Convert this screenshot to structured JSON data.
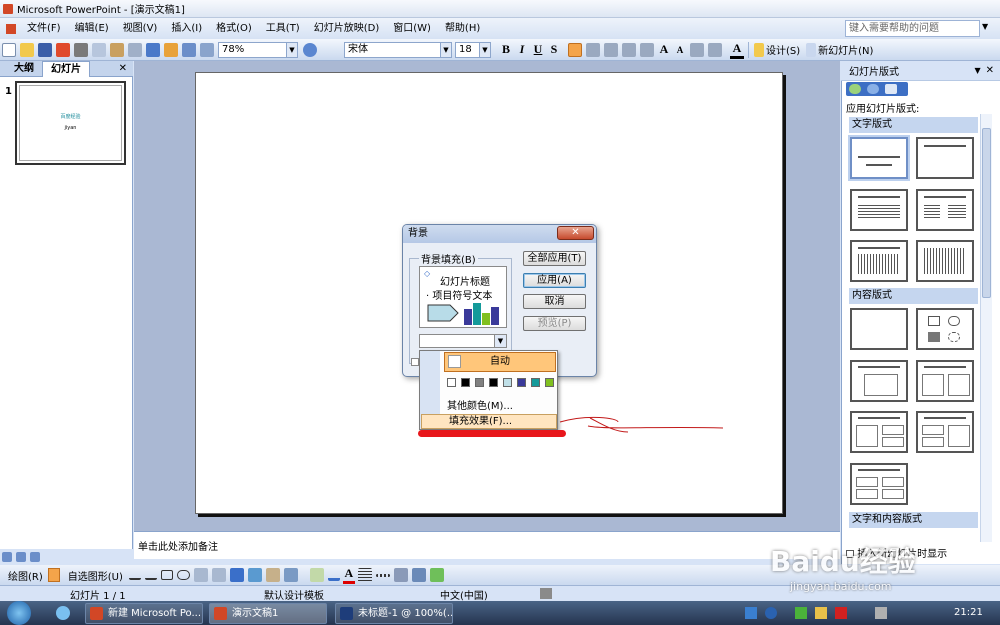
{
  "title_bar": {
    "title": "Microsoft PowerPoint - [演示文稿1]"
  },
  "menu": {
    "items": [
      "文件(F)",
      "编辑(E)",
      "视图(V)",
      "插入(I)",
      "格式(O)",
      "工具(T)",
      "幻灯片放映(D)",
      "窗口(W)",
      "帮助(H)"
    ],
    "help_placeholder": "键入需要帮助的问题"
  },
  "toolbar": {
    "zoom": "78%",
    "font": "宋体",
    "font_size": "18",
    "bold": "B",
    "italic": "I",
    "underline": "U",
    "shadow": "S",
    "design_label": "设计(S)",
    "new_slide_label": "新幻灯片(N)"
  },
  "left_pane": {
    "tabs": [
      "大纲",
      "幻灯片"
    ],
    "slide_number": "1",
    "thumb_title": "百度经验",
    "thumb_sub": "jiyan"
  },
  "notes": {
    "placeholder": "单击此处添加备注"
  },
  "task_pane": {
    "title": "幻灯片版式",
    "apply_label": "应用幻灯片版式:",
    "sections": [
      "文字版式",
      "内容版式",
      "文字和内容版式"
    ],
    "footer": "插入新幻灯片时显示"
  },
  "dialog": {
    "title": "背景",
    "group_label": "背景填充(B)",
    "preview_title": "幻灯片标题",
    "preview_bullet": "· 项目符号文本",
    "buttons": {
      "apply_all": "全部应用(T)",
      "apply": "应用(A)",
      "cancel": "取消",
      "preview": "预览(P)"
    },
    "popup": {
      "auto": "自动",
      "more_colors": "其他颜色(M)...",
      "fill_effects": "填充效果(F)...",
      "swatches": [
        "#ffffff",
        "#000000",
        "#808080",
        "#000000",
        "#c0e0e8",
        "#3a3a9a",
        "#149a9a",
        "#80c020"
      ]
    }
  },
  "draw_toolbar": {
    "draw_label": "绘图(R)",
    "autoshape_label": "自选图形(U)"
  },
  "status_bar": {
    "slide_info": "幻灯片 1 / 1",
    "template": "默认设计模板",
    "language": "中文(中国)"
  },
  "taskbar": {
    "buttons": [
      "新建 Microsoft Po...",
      "演示文稿1",
      "未标题-1 @ 100%(..."
    ],
    "clock": "21:21"
  },
  "watermark": {
    "text": "Baidu经验",
    "url": "jingyan.baidu.com"
  },
  "colors": {
    "accent": "#3d6fc4",
    "highlight": "#ffd9a0",
    "red_mark": "#e8161b"
  }
}
